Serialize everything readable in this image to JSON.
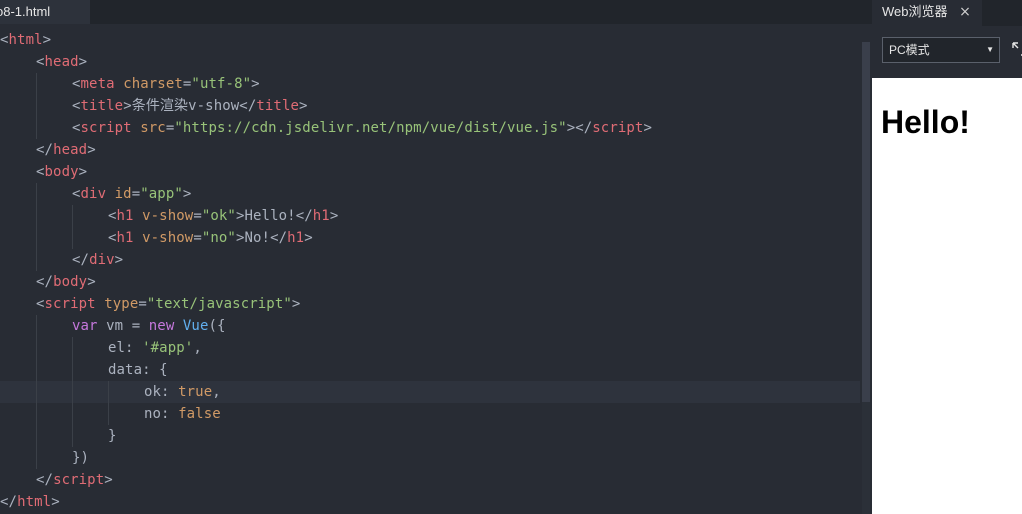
{
  "editor": {
    "tab_label": "o8-1.html",
    "current_line_index": 16,
    "lines": [
      {
        "indent": 0,
        "tokens": [
          [
            "punc",
            "<"
          ],
          [
            "tag",
            "html"
          ],
          [
            "punc",
            ">"
          ]
        ]
      },
      {
        "indent": 1,
        "tokens": [
          [
            "punc",
            "<"
          ],
          [
            "tag",
            "head"
          ],
          [
            "punc",
            ">"
          ]
        ]
      },
      {
        "indent": 2,
        "tokens": [
          [
            "punc",
            "<"
          ],
          [
            "tag",
            "meta "
          ],
          [
            "attr",
            "charset"
          ],
          [
            "punc",
            "="
          ],
          [
            "str",
            "\"utf-8\""
          ],
          [
            "punc",
            ">"
          ]
        ]
      },
      {
        "indent": 2,
        "tokens": [
          [
            "punc",
            "<"
          ],
          [
            "tag",
            "title"
          ],
          [
            "punc",
            ">"
          ],
          [
            "txt",
            "条件渲染v-show"
          ],
          [
            "punc",
            "</"
          ],
          [
            "tag",
            "title"
          ],
          [
            "punc",
            ">"
          ]
        ]
      },
      {
        "indent": 2,
        "tokens": [
          [
            "punc",
            "<"
          ],
          [
            "tag",
            "script "
          ],
          [
            "attr",
            "src"
          ],
          [
            "punc",
            "="
          ],
          [
            "str",
            "\"https://cdn.jsdelivr.net/npm/vue/dist/vue.js\""
          ],
          [
            "punc",
            "></"
          ],
          [
            "tag",
            "script"
          ],
          [
            "punc",
            ">"
          ]
        ]
      },
      {
        "indent": 1,
        "tokens": [
          [
            "punc",
            "</"
          ],
          [
            "tag",
            "head"
          ],
          [
            "punc",
            ">"
          ]
        ]
      },
      {
        "indent": 1,
        "tokens": [
          [
            "punc",
            "<"
          ],
          [
            "tag",
            "body"
          ],
          [
            "punc",
            ">"
          ]
        ]
      },
      {
        "indent": 2,
        "tokens": [
          [
            "punc",
            "<"
          ],
          [
            "tag",
            "div "
          ],
          [
            "attr",
            "id"
          ],
          [
            "punc",
            "="
          ],
          [
            "str",
            "\"app\""
          ],
          [
            "punc",
            ">"
          ]
        ]
      },
      {
        "indent": 3,
        "tokens": [
          [
            "punc",
            "<"
          ],
          [
            "tag",
            "h1 "
          ],
          [
            "attr",
            "v-show"
          ],
          [
            "punc",
            "="
          ],
          [
            "str",
            "\"ok\""
          ],
          [
            "punc",
            ">"
          ],
          [
            "txt",
            "Hello!"
          ],
          [
            "punc",
            "</"
          ],
          [
            "tag",
            "h1"
          ],
          [
            "punc",
            ">"
          ]
        ]
      },
      {
        "indent": 3,
        "tokens": [
          [
            "punc",
            "<"
          ],
          [
            "tag",
            "h1 "
          ],
          [
            "attr",
            "v-show"
          ],
          [
            "punc",
            "="
          ],
          [
            "str",
            "\"no\""
          ],
          [
            "punc",
            ">"
          ],
          [
            "txt",
            "No!"
          ],
          [
            "punc",
            "</"
          ],
          [
            "tag",
            "h1"
          ],
          [
            "punc",
            ">"
          ]
        ]
      },
      {
        "indent": 2,
        "tokens": [
          [
            "punc",
            "</"
          ],
          [
            "tag",
            "div"
          ],
          [
            "punc",
            ">"
          ]
        ]
      },
      {
        "indent": 1,
        "tokens": [
          [
            "punc",
            "</"
          ],
          [
            "tag",
            "body"
          ],
          [
            "punc",
            ">"
          ]
        ]
      },
      {
        "indent": 1,
        "tokens": [
          [
            "punc",
            "<"
          ],
          [
            "tag",
            "script "
          ],
          [
            "attr",
            "type"
          ],
          [
            "punc",
            "="
          ],
          [
            "str",
            "\"text/javascript\""
          ],
          [
            "punc",
            ">"
          ]
        ]
      },
      {
        "indent": 2,
        "tokens": [
          [
            "kw",
            "var "
          ],
          [
            "txt",
            "vm = "
          ],
          [
            "kw",
            "new "
          ],
          [
            "cls",
            "Vue"
          ],
          [
            "txt",
            "({"
          ]
        ]
      },
      {
        "indent": 3,
        "tokens": [
          [
            "txt",
            "el: "
          ],
          [
            "str",
            "'#app'"
          ],
          [
            "txt",
            ","
          ]
        ]
      },
      {
        "indent": 3,
        "tokens": [
          [
            "txt",
            "data: {"
          ]
        ]
      },
      {
        "indent": 4,
        "tokens": [
          [
            "txt",
            "ok: "
          ],
          [
            "bool",
            "true"
          ],
          [
            "txt",
            ","
          ]
        ]
      },
      {
        "indent": 4,
        "tokens": [
          [
            "txt",
            "no: "
          ],
          [
            "bool",
            "false"
          ]
        ]
      },
      {
        "indent": 3,
        "tokens": [
          [
            "txt",
            "}"
          ]
        ]
      },
      {
        "indent": 2,
        "tokens": [
          [
            "txt",
            "})"
          ]
        ]
      },
      {
        "indent": 1,
        "tokens": [
          [
            "punc",
            "</"
          ],
          [
            "tag",
            "script"
          ],
          [
            "punc",
            ">"
          ]
        ]
      },
      {
        "indent": 0,
        "tokens": [
          [
            "punc",
            "</"
          ],
          [
            "tag",
            "html"
          ],
          [
            "punc",
            ">"
          ]
        ]
      }
    ]
  },
  "browser": {
    "tab_label": "Web浏览器",
    "close_glyph": "×",
    "mode_value": "PC模式",
    "caret_glyph": "▼",
    "expand_icon": "expand-icon",
    "heading": "Hello!"
  },
  "colors": {
    "editor_bg": "#282c34",
    "tag": "#e06c75",
    "attribute": "#d19a66",
    "string": "#98c379",
    "keyword": "#c678dd",
    "class": "#61afef",
    "text": "#abb2bf"
  }
}
